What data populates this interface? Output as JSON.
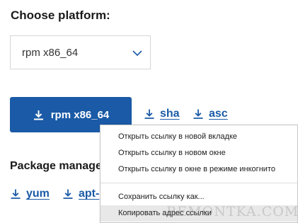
{
  "platform": {
    "heading": "Choose platform:",
    "selected": "rpm x86_64"
  },
  "download": {
    "button_label": "rpm x86_64",
    "sha_label": "sha",
    "asc_label": "asc"
  },
  "packages": {
    "heading": "Package manage",
    "yum_label": "yum",
    "apt_label": "apt-"
  },
  "context_menu": {
    "items": [
      "Открыть ссылку в новой вкладке",
      "Открыть ссылку в новом окне",
      "Открыть ссылку в окне в режиме инкогнито",
      "Сохранить ссылку как...",
      "Копировать адрес ссылки"
    ]
  },
  "watermark": "REMONTKA.COM",
  "colors": {
    "accent": "#1a5aa6",
    "menu_hover": "#e8e8e8"
  },
  "icons": {
    "download": "download-icon",
    "chevron": "chevron-down-icon"
  }
}
